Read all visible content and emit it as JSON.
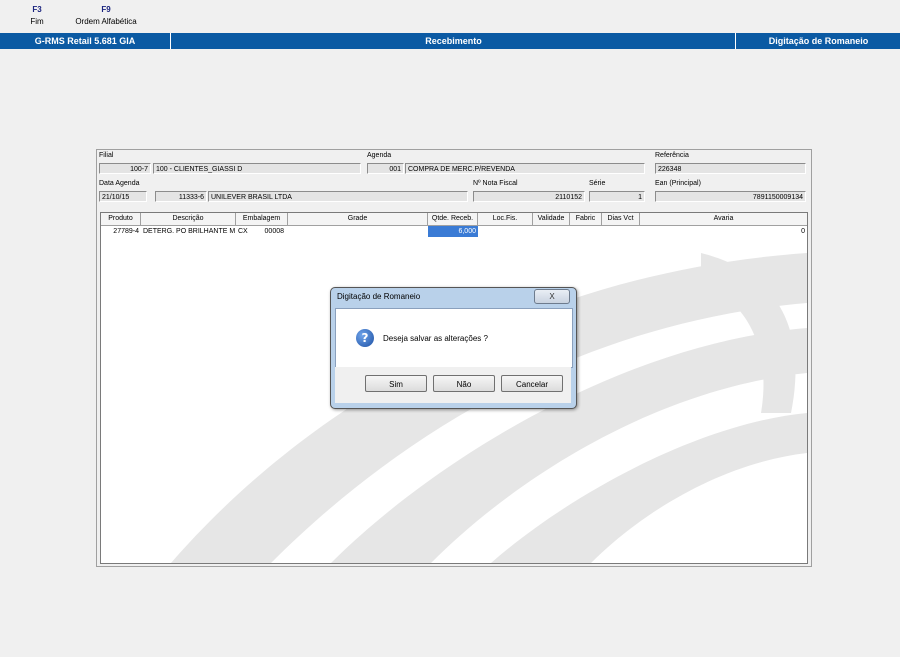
{
  "toolbar": {
    "keys": [
      {
        "key": "F3",
        "label": "Fim"
      },
      {
        "key": "F9",
        "label": "Ordem Alfabética"
      }
    ]
  },
  "titlebar": {
    "app": "G-RMS Retail 5.681 GIA",
    "module": "Recebimento",
    "screen": "Digitação de Romaneio"
  },
  "form": {
    "filial_label": "Filial",
    "filial_code": "100-7",
    "filial_name": "100 - CLIENTES_GIASSI D",
    "agenda_label": "Agenda",
    "agenda_code": "001",
    "agenda_name": "COMPRA DE MERC.P/REVENDA",
    "referencia_label": "Referência",
    "referencia": "226348",
    "data_agenda_label": "Data Agenda",
    "data_agenda": "21/10/15",
    "fornecedor_code": "11333-6",
    "fornecedor_name": "UNILEVER BRASIL LTDA",
    "nota_label": "Nº Nota Fiscal",
    "nota": "2110152",
    "serie_label": "Série",
    "serie": "1",
    "ean_label": "Ean (Principal)",
    "ean": "7891150009134"
  },
  "grid": {
    "columns": [
      "Produto",
      "Descrição",
      "Embalagem",
      "Grade",
      "Qtde. Receb.",
      "Loc.Fis.",
      "Validade",
      "Fabric",
      "Dias Vct",
      "Avaria"
    ],
    "rows": [
      {
        "produto": "27789-4",
        "descricao": "DETERG. PO BRILHANTE M",
        "emb_tipo": "CX",
        "emb_qtd": "00008",
        "qtde": "6,000",
        "avaria": "0"
      }
    ]
  },
  "dialog": {
    "title": "Digitação de Romaneio",
    "close": "X",
    "message": "Deseja salvar as alterações ?",
    "icon": "question-icon",
    "buttons": {
      "yes": "Sim",
      "no": "Não",
      "cancel": "Cancelar"
    }
  },
  "colors": {
    "titlebar": "#0b5aa3",
    "selected_cell": "#3a7bd5"
  }
}
